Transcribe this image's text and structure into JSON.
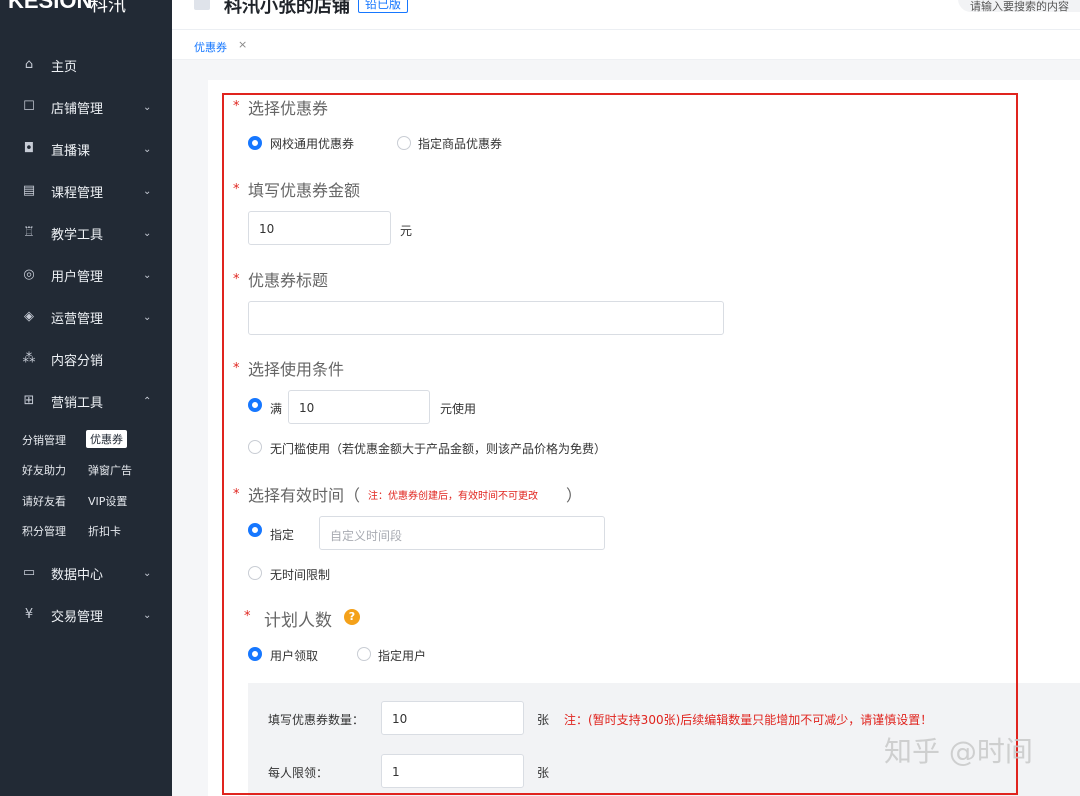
{
  "sidebar": {
    "brand": "KESION",
    "brand_cn": "科汛",
    "items": [
      {
        "label": "主页",
        "icon": "home-icon"
      },
      {
        "label": "店铺管理",
        "icon": "store-icon"
      },
      {
        "label": "直播课",
        "icon": "live-icon"
      },
      {
        "label": "课程管理",
        "icon": "course-icon"
      },
      {
        "label": "教学工具",
        "icon": "teach-tool-icon"
      },
      {
        "label": "用户管理",
        "icon": "user-icon"
      },
      {
        "label": "运营管理",
        "icon": "operation-icon"
      },
      {
        "label": "内容分销",
        "icon": "distribution-icon"
      },
      {
        "label": "营销工具",
        "icon": "gift-icon"
      },
      {
        "label": "数据中心",
        "icon": "chart-icon"
      },
      {
        "label": "交易管理",
        "icon": "yen-icon"
      }
    ],
    "marketing_sub": [
      [
        "分销管理",
        "优惠券"
      ],
      [
        "好友助力",
        "弹窗广告"
      ],
      [
        "请好友看",
        "VIP设置"
      ],
      [
        "积分管理",
        "折扣卡"
      ]
    ],
    "active_sub": "优惠券"
  },
  "header": {
    "store_title": "科汛小张的店铺",
    "version_badge": "铅已版",
    "search_placeholder": "请输入要搜索的内容"
  },
  "tab": {
    "label": "优惠券",
    "close": "×"
  },
  "form": {
    "select_coupon": {
      "title": "选择优惠券",
      "options": [
        "网校通用优惠券",
        "指定商品优惠券"
      ],
      "selected": "网校通用优惠券"
    },
    "amount": {
      "title": "填写优惠券金额",
      "value": "10",
      "unit": "元"
    },
    "coupon_title": {
      "title": "优惠券标题",
      "value": ""
    },
    "conditions": {
      "title": "选择使用条件",
      "option1_prefix": "满",
      "option1_value": "10",
      "option1_suffix": "元使用",
      "option2": "无门槛使用（若优惠金额大于产品金额，则该产品价格为免费）",
      "selected": "满"
    },
    "validity": {
      "title": "选择有效时间（",
      "note": "注：优惠券创建后，有效时间不可更改",
      "close_paren": "）",
      "option1": "指定",
      "option1_placeholder": "自定义时间段",
      "option2": "无时间限制",
      "selected": "指定"
    },
    "plan": {
      "title": "计划人数",
      "help": "?",
      "options": [
        "用户领取",
        "指定用户"
      ],
      "selected": "用户领取",
      "quantity_label": "填写优惠券数量：",
      "quantity_value": "10",
      "quantity_unit": "张",
      "quantity_note": "注：(暂时支持300张)后续编辑数量只能增加不可减少，请谨慎设置！",
      "limit_label": "每人限领：",
      "limit_value": "1",
      "limit_unit": "张"
    },
    "required_mark": "*"
  },
  "watermark": "知乎 @时间"
}
